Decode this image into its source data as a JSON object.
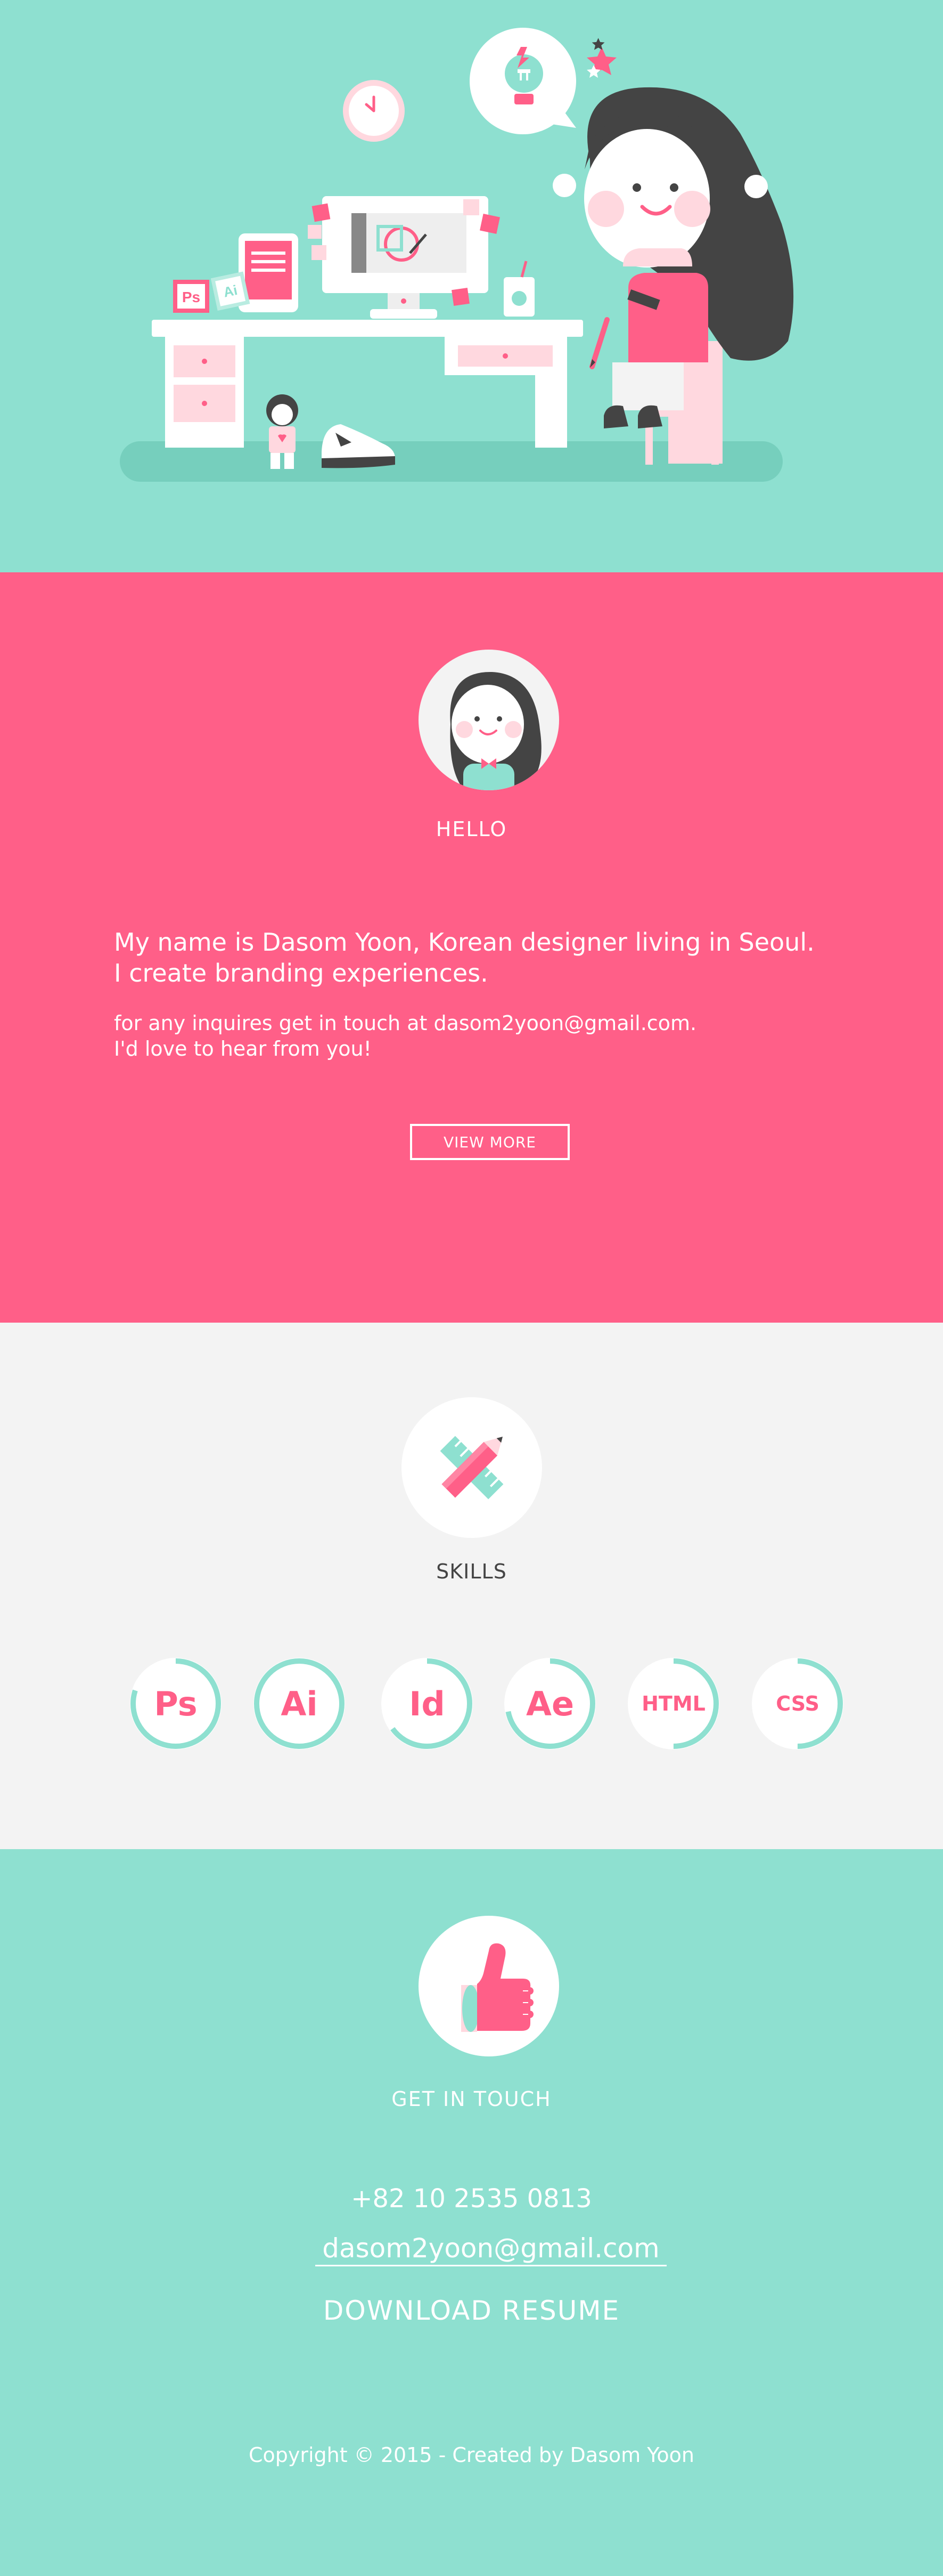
{
  "hero": {
    "illustration": "designer-at-desk",
    "desk_badges": [
      "Ps",
      "Ai"
    ],
    "colors": {
      "background": "#8ee0d0",
      "pink": "#ff5f88",
      "dark": "#444444"
    }
  },
  "about": {
    "avatar_icon": "girl-avatar-icon",
    "heading": "HELLO",
    "intro_lines": [
      "My name is Dasom Yoon, Korean designer living in Seoul.",
      "I create branding experiences."
    ],
    "contact_lines": [
      "for any inquires get in touch at dasom2yoon@gmail.com.",
      "I'd love to hear from you!"
    ],
    "view_more_label": "VIEW MORE",
    "colors": {
      "background": "#ff5f88"
    }
  },
  "skills": {
    "icon": "pencil-ruler-icon",
    "heading": "SKILLS",
    "items": [
      {
        "label": "Ps",
        "level": 0.8
      },
      {
        "label": "Ai",
        "level": 1.0
      },
      {
        "label": "Id",
        "level": 0.65
      },
      {
        "label": "Ae",
        "level": 0.72
      },
      {
        "label": "HTML",
        "level": 0.5
      },
      {
        "label": "CSS",
        "level": 0.5
      }
    ],
    "colors": {
      "ring": "#8ee0d0",
      "label": "#ff5f88",
      "background": "#f3f3f3"
    }
  },
  "contact": {
    "icon": "thumbs-up-icon",
    "heading": "GET IN TOUCH",
    "phone": "+82 10 2535 0813",
    "email": "dasom2yoon@gmail.com",
    "download_label": "DOWNLOAD RESUME",
    "copyright": "Copyright © 2015 - Created by Dasom Yoon",
    "colors": {
      "background": "#8ee0d0"
    }
  }
}
